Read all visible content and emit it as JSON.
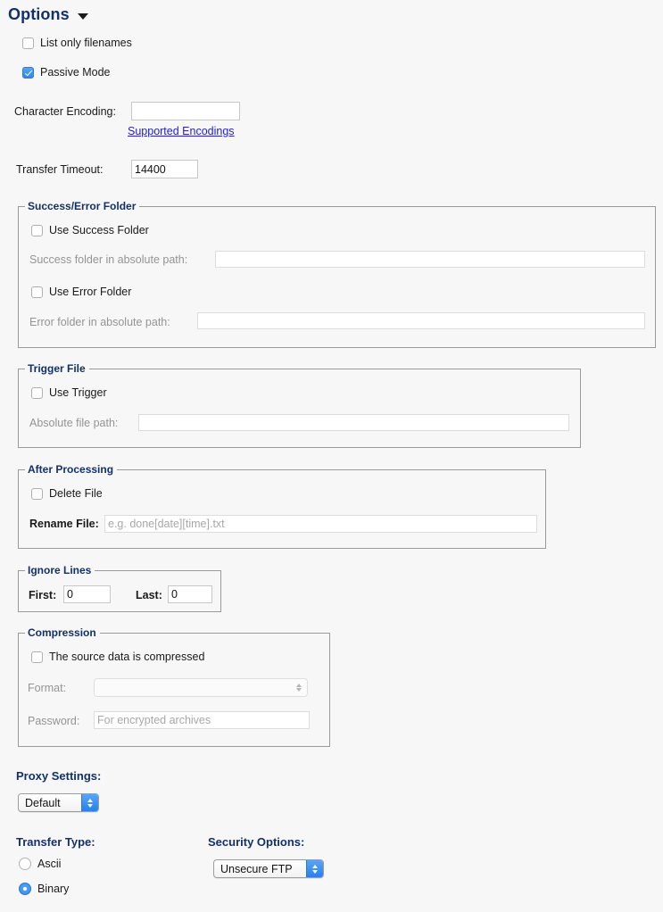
{
  "header": {
    "title": "Options",
    "disclosure_icon": "triangle-down-icon"
  },
  "top_checkboxes": [
    {
      "label": "List only filenames",
      "checked": false
    },
    {
      "label": "Passive Mode",
      "checked": true
    }
  ],
  "character_encoding": {
    "label": "Character Encoding:",
    "value": "",
    "placeholder": "",
    "link_label": "Supported Encodings"
  },
  "transfer_timeout": {
    "label": "Transfer Timeout:",
    "value": "14400"
  },
  "success_error_folder": {
    "legend": "Success/Error Folder",
    "use_success_folder": {
      "label": "Use Success Folder",
      "checked": false
    },
    "success_path": {
      "label": "Success folder in absolute path:",
      "value": "",
      "placeholder": "",
      "disabled": true
    },
    "use_error_folder": {
      "label": "Use Error Folder",
      "checked": false
    },
    "error_path": {
      "label": "Error folder in absolute path:",
      "value": "",
      "placeholder": "",
      "disabled": true
    }
  },
  "trigger_file": {
    "legend": "Trigger File",
    "use_trigger": {
      "label": "Use Trigger",
      "checked": false
    },
    "absolute_path": {
      "label": "Absolute file path:",
      "value": "",
      "placeholder": "",
      "disabled": true
    }
  },
  "after_processing": {
    "legend": "After Processing",
    "delete_file": {
      "label": "Delete File",
      "checked": false
    },
    "rename_file": {
      "label": "Rename File:",
      "value": "",
      "placeholder": "e.g. done[date][time].txt"
    }
  },
  "ignore_lines": {
    "legend": "Ignore Lines",
    "first": {
      "label": "First:",
      "value": "0"
    },
    "last": {
      "label": "Last:",
      "value": "0"
    }
  },
  "compression": {
    "legend": "Compression",
    "source_compressed": {
      "label": "The source data is compressed",
      "checked": false
    },
    "format": {
      "label": "Format:",
      "value": "",
      "disabled": true
    },
    "password": {
      "label": "Password:",
      "value": "",
      "placeholder": "For encrypted archives",
      "disabled": true
    }
  },
  "proxy_settings": {
    "title": "Proxy Settings:",
    "selected": "Default"
  },
  "transfer_type": {
    "title": "Transfer Type:",
    "options": [
      {
        "label": "Ascii",
        "selected": false
      },
      {
        "label": "Binary",
        "selected": true
      }
    ]
  },
  "security_options": {
    "title": "Security Options:",
    "selected": "Unsecure FTP"
  },
  "colors": {
    "background": "#f7f7f7",
    "legend_blue": "#14306b",
    "accent_blue": "#2f86f0",
    "link_blue": "#2222cc",
    "disabled_text": "#949494"
  }
}
